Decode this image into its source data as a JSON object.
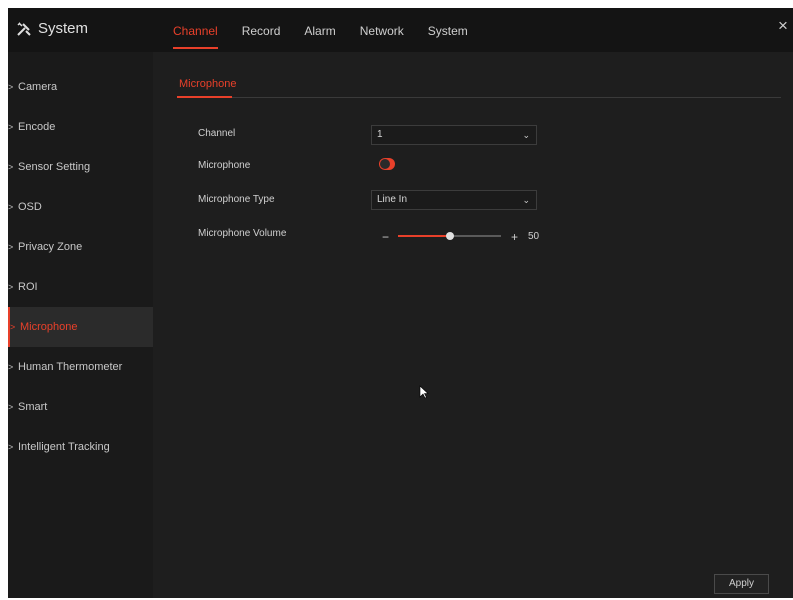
{
  "app": {
    "title": "System",
    "logo_icon": "tools-icon",
    "close_icon": "close-icon",
    "close_glyph": "×"
  },
  "tabs": [
    {
      "label": "Channel",
      "active": true
    },
    {
      "label": "Record"
    },
    {
      "label": "Alarm"
    },
    {
      "label": "Network"
    },
    {
      "label": "System"
    }
  ],
  "sidebar": {
    "items": [
      {
        "label": "Camera"
      },
      {
        "label": "Encode"
      },
      {
        "label": "Sensor Setting"
      },
      {
        "label": "OSD"
      },
      {
        "label": "Privacy Zone"
      },
      {
        "label": "ROI"
      },
      {
        "label": "Microphone",
        "active": true
      },
      {
        "label": "Human Thermometer"
      },
      {
        "label": "Smart"
      },
      {
        "label": "Intelligent Tracking"
      }
    ]
  },
  "content": {
    "subtab": "Microphone",
    "fields": {
      "channel": {
        "label": "Channel",
        "value": "1"
      },
      "microphone": {
        "label": "Microphone",
        "enabled": true
      },
      "microphone_type": {
        "label": "Microphone Type",
        "value": "Line In"
      },
      "microphone_volume": {
        "label": "Microphone Volume",
        "value": 50,
        "minus": "−",
        "plus": "+"
      }
    },
    "apply_label": "Apply"
  },
  "colors": {
    "accent": "#e8402a",
    "background": "#1e1e1e",
    "topbar": "#141414"
  }
}
